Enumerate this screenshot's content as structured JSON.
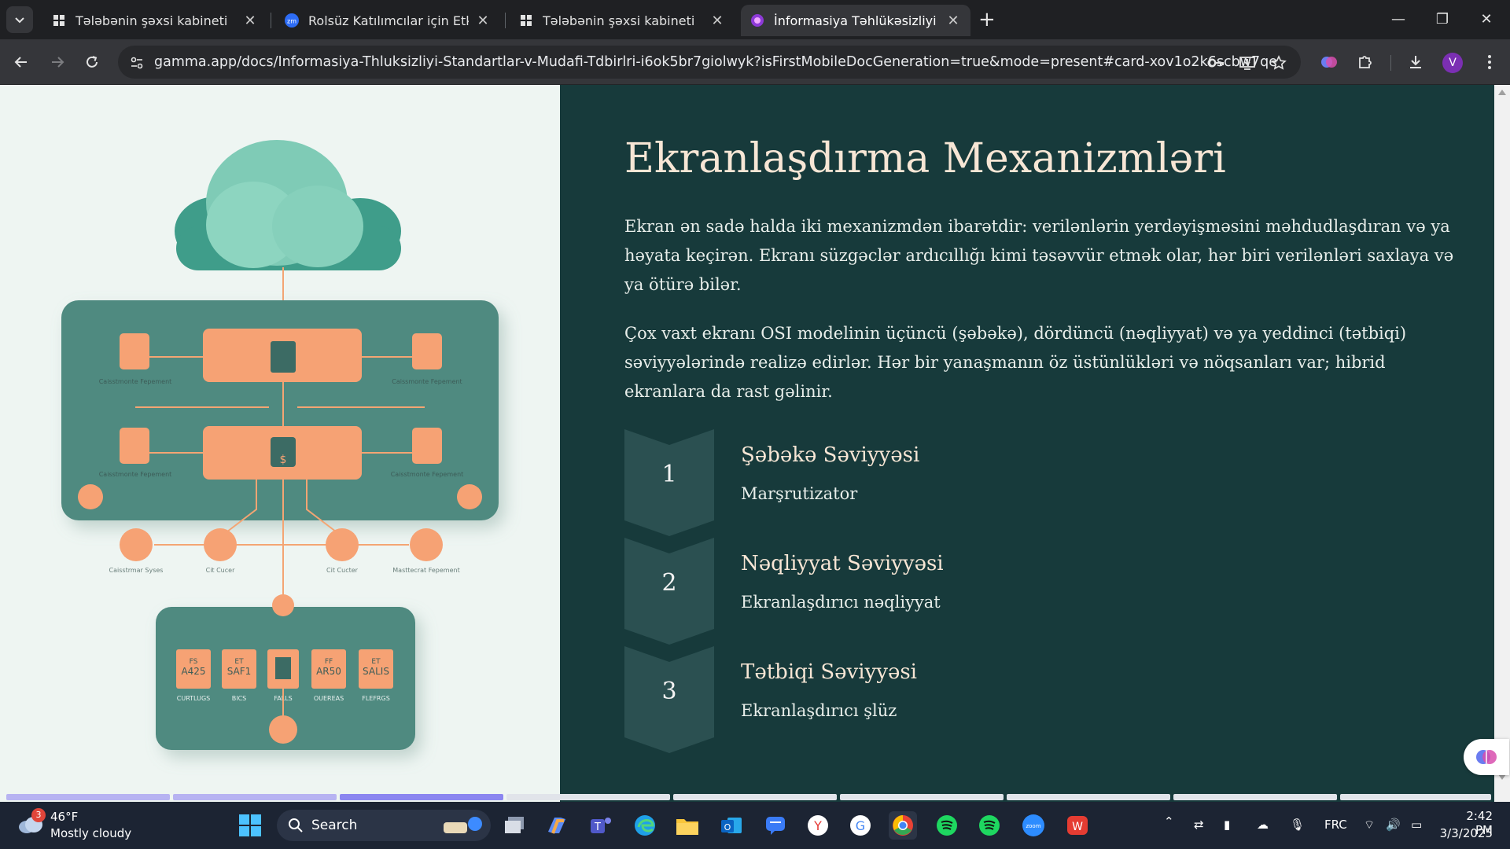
{
  "tabs": [
    {
      "title": "Tələbənin şəxsi kabineti",
      "active": false
    },
    {
      "title": "Rolsüz Katılımcılar için Etkinlik S",
      "active": false
    },
    {
      "title": "Tələbənin şəxsi kabineti",
      "active": false
    },
    {
      "title": "İnformasiya Təhlükəsizliyi Stand",
      "active": true
    }
  ],
  "toolbar": {
    "url": "gamma.app/docs/Informasiya-Thluksizliyi-Standartlar-v-Mudafi-Tdbirlri-i6ok5br7giolwyk?isFirstMobileDocGeneration=true&mode=present#card-xov1o2k6scbw7qe",
    "profile_initial": "V"
  },
  "slide": {
    "title": "Ekranlaşdırma Mexanizmləri",
    "paragraph1": "Ekran ən sadə halda iki mexanizmdən ibarətdir: verilənlərin yerdəyişməsini məhdudlaşdıran və ya həyata keçirən. Ekranı süzgəclər ardıcıllığı kimi təsəvvür etmək olar, hər biri verilənləri saxlaya və ya ötürə bilər.",
    "paragraph2": "Çox vaxt ekranı OSI modelinin üçüncü (şəbəkə), dördüncü (nəqliyyat) və ya yeddinci (tətbiqi) səviyyələrində realizə edirlər. Hər bir yanaşmanın öz üstünlükləri və nöqsanları var; hibrid ekranlara da rast gəlinir.",
    "steps": [
      {
        "number": "1",
        "title": "Şəbəkə Səviyyəsi",
        "subtitle": "Marşrutizator"
      },
      {
        "number": "2",
        "title": "Nəqliyyat Səviyyəsi",
        "subtitle": "Ekranlaşdırıcı nəqliyyat"
      },
      {
        "number": "3",
        "title": "Tətbiqi Səviyyəsi",
        "subtitle": "Ekranlaşdırıcı şlüz"
      }
    ]
  },
  "illustration": {
    "labels": {
      "node_tl": "Caisstmonte Fepement",
      "node_tr": "Caissmonte Fepement",
      "node_bl": "Caisstmonte Fepement",
      "node_br": "Caisstmonte Fepement",
      "circle1": "Caisstrmar Syses",
      "circle2": "Cit Cucer",
      "circle3": "Cit Cucter",
      "circle4": "Masttecrat Fepement"
    },
    "boxes": [
      {
        "top": "FS",
        "main": "A425",
        "caption": "CURTLUGS"
      },
      {
        "top": "ET",
        "main": "SAF1",
        "caption": "BICS"
      },
      {
        "top": "",
        "main": "",
        "caption": "FALLS"
      },
      {
        "top": "FF",
        "main": "AR50",
        "caption": "OUEREAS"
      },
      {
        "top": "ET",
        "main": "SALIS",
        "caption": "FLEFRGS"
      }
    ],
    "cloud_color": "#6cc3ad",
    "panel_color": "#4f8a80",
    "accent_color": "#f5a271"
  },
  "taskbar": {
    "weather_temp": "46°F",
    "weather_cond": "Mostly cloudy",
    "weather_badge": "3",
    "search_label": "Search",
    "lang": "FRC",
    "time": "2:42 PM",
    "date": "3/3/2025"
  },
  "colors": {
    "slide_bg": "#173a3b",
    "title_color": "#f7e6d5",
    "progress_active": "#8b86f0"
  }
}
